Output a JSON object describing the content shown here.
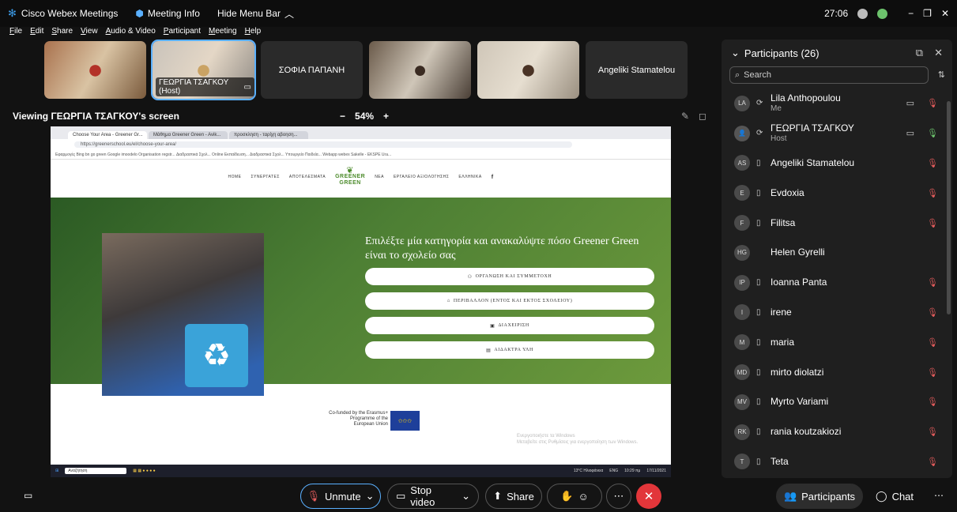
{
  "topbar": {
    "app_name": "Cisco Webex Meetings",
    "meeting_info": "Meeting Info",
    "hide_menu": "Hide Menu Bar",
    "timer": "27:06"
  },
  "menu": [
    "File",
    "Edit",
    "Share",
    "View",
    "Audio & Video",
    "Participant",
    "Meeting",
    "Help"
  ],
  "videos": [
    {
      "name": "",
      "type": "video"
    },
    {
      "name": "ΓΕΩΡΓΙΑ ΤΣΑΓΚΟΥ (Host)",
      "type": "video"
    },
    {
      "name": "ΣΟΦΙΑ ΠΑΠΑΝΗ",
      "type": "text"
    },
    {
      "name": "",
      "type": "video"
    },
    {
      "name": "",
      "type": "video"
    },
    {
      "name": "Angeliki Stamatelou",
      "type": "text"
    }
  ],
  "viewing": {
    "label": "Viewing ΓΕΩΡΓΙΑ ΤΣΑΓΚΟΥ's screen",
    "zoom_minus": "−",
    "zoom": "54%",
    "zoom_plus": "+"
  },
  "shared": {
    "tabs": [
      "Choose Your Area - Greener Gr...",
      "Μάθημα Greener Green - Avik...",
      "προσκληση - ταρίχη αβοηση..."
    ],
    "url": "https://greenerschool.eu/el/choose-your-area/",
    "bookmarks": "Εφαρμογές   Bing   bn go green   Google   imoodelo   Organisation regstr...   Διαδραστικά Σχολ...   Online Εκπαίδευση...   Διαδραστικά Σχολ...   Υπουργείο Παιδεία...   Webapp   webex   Sakelle - EKSPE Ura...",
    "nav": [
      "HOME",
      "ΣΥΝΕΡΓΑΤΕΣ",
      "ΑΠΟΤΕΛΕΣΜΑΤΑ",
      "ΝΕΑ",
      "ΕΡΓΑΛΕΙΟ ΑΞΙΟΛΟΓΗΣΗΣ",
      "ΕΛΛΗΝΙΚΑ"
    ],
    "logo_line1": "GREENER",
    "logo_line2": "GREEN",
    "hero_title": "Επιλέξτε μία κατηγορία και ανακαλύψτε πόσο Greener Green είναι το σχολείο σας",
    "categories": [
      "ΟΡΓΑΝΩΣΗ ΚΑΙ ΣΥΜΜΕΤΟΧΗ",
      "ΠΕΡΙΒΑΛΛΟΝ (ΕΝΤΟΣ ΚΑΙ ΕΚΤΟΣ ΣΧΟΛΕΙΟΥ)",
      "ΔΙΑΧΕΙΡΙΣΗ",
      "ΑΙΔΑΚΤΡΑ ΥΛΗ"
    ],
    "funded": "Co-funded by the Erasmus+ Programme of the European Union",
    "watermark_line1": "Ενεργοποιήστε τα Windows",
    "watermark_line2": "Μεταβείτε στις Ρυθμίσεις για ενεργοποίηση των Windows.",
    "taskbar_search": "Αναζήτηση",
    "taskbar_weather": "13°C Ηλιοφάνεια",
    "taskbar_lang": "ENG",
    "taskbar_time": "10:29 πμ",
    "taskbar_date": "17/11/2021"
  },
  "panel": {
    "title": "Participants (26)",
    "search_placeholder": "Search",
    "participants": [
      {
        "initials": "LA",
        "name": "Lila Anthopoulou",
        "sub": "Me",
        "cam": true,
        "mic": "muted"
      },
      {
        "initials": "",
        "name": "ΓΕΩΡΓΙΑ ΤΣΑΓΚΟΥ",
        "sub": "Host",
        "cam": true,
        "mic": "on"
      },
      {
        "initials": "AS",
        "name": "Angeliki Stamatelou",
        "sub": "",
        "cam": false,
        "mic": "muted"
      },
      {
        "initials": "E",
        "name": "Evdoxia",
        "sub": "",
        "cam": false,
        "mic": "muted"
      },
      {
        "initials": "F",
        "name": "Filitsa",
        "sub": "",
        "cam": false,
        "mic": "muted"
      },
      {
        "initials": "HG",
        "name": "Helen Gyrelli",
        "sub": "",
        "cam": false,
        "mic": "none"
      },
      {
        "initials": "IP",
        "name": "Ioanna Panta",
        "sub": "",
        "cam": false,
        "mic": "muted"
      },
      {
        "initials": "I",
        "name": "irene",
        "sub": "",
        "cam": false,
        "mic": "muted"
      },
      {
        "initials": "M",
        "name": "maria",
        "sub": "",
        "cam": false,
        "mic": "muted"
      },
      {
        "initials": "MD",
        "name": "mirto diolatzi",
        "sub": "",
        "cam": false,
        "mic": "muted"
      },
      {
        "initials": "MV",
        "name": "Myrto Variami",
        "sub": "",
        "cam": false,
        "mic": "muted"
      },
      {
        "initials": "RK",
        "name": "rania koutzakiozi",
        "sub": "",
        "cam": false,
        "mic": "muted"
      },
      {
        "initials": "T",
        "name": "Teta",
        "sub": "",
        "cam": false,
        "mic": "muted"
      }
    ]
  },
  "controls": {
    "unmute": "Unmute",
    "stop_video": "Stop video",
    "share": "Share",
    "participants": "Participants",
    "chat": "Chat"
  },
  "colors": {
    "accent": "#5ab0ff",
    "leave": "#e2363a",
    "muted": "#e25b5b",
    "green": "#4c8b2b"
  }
}
